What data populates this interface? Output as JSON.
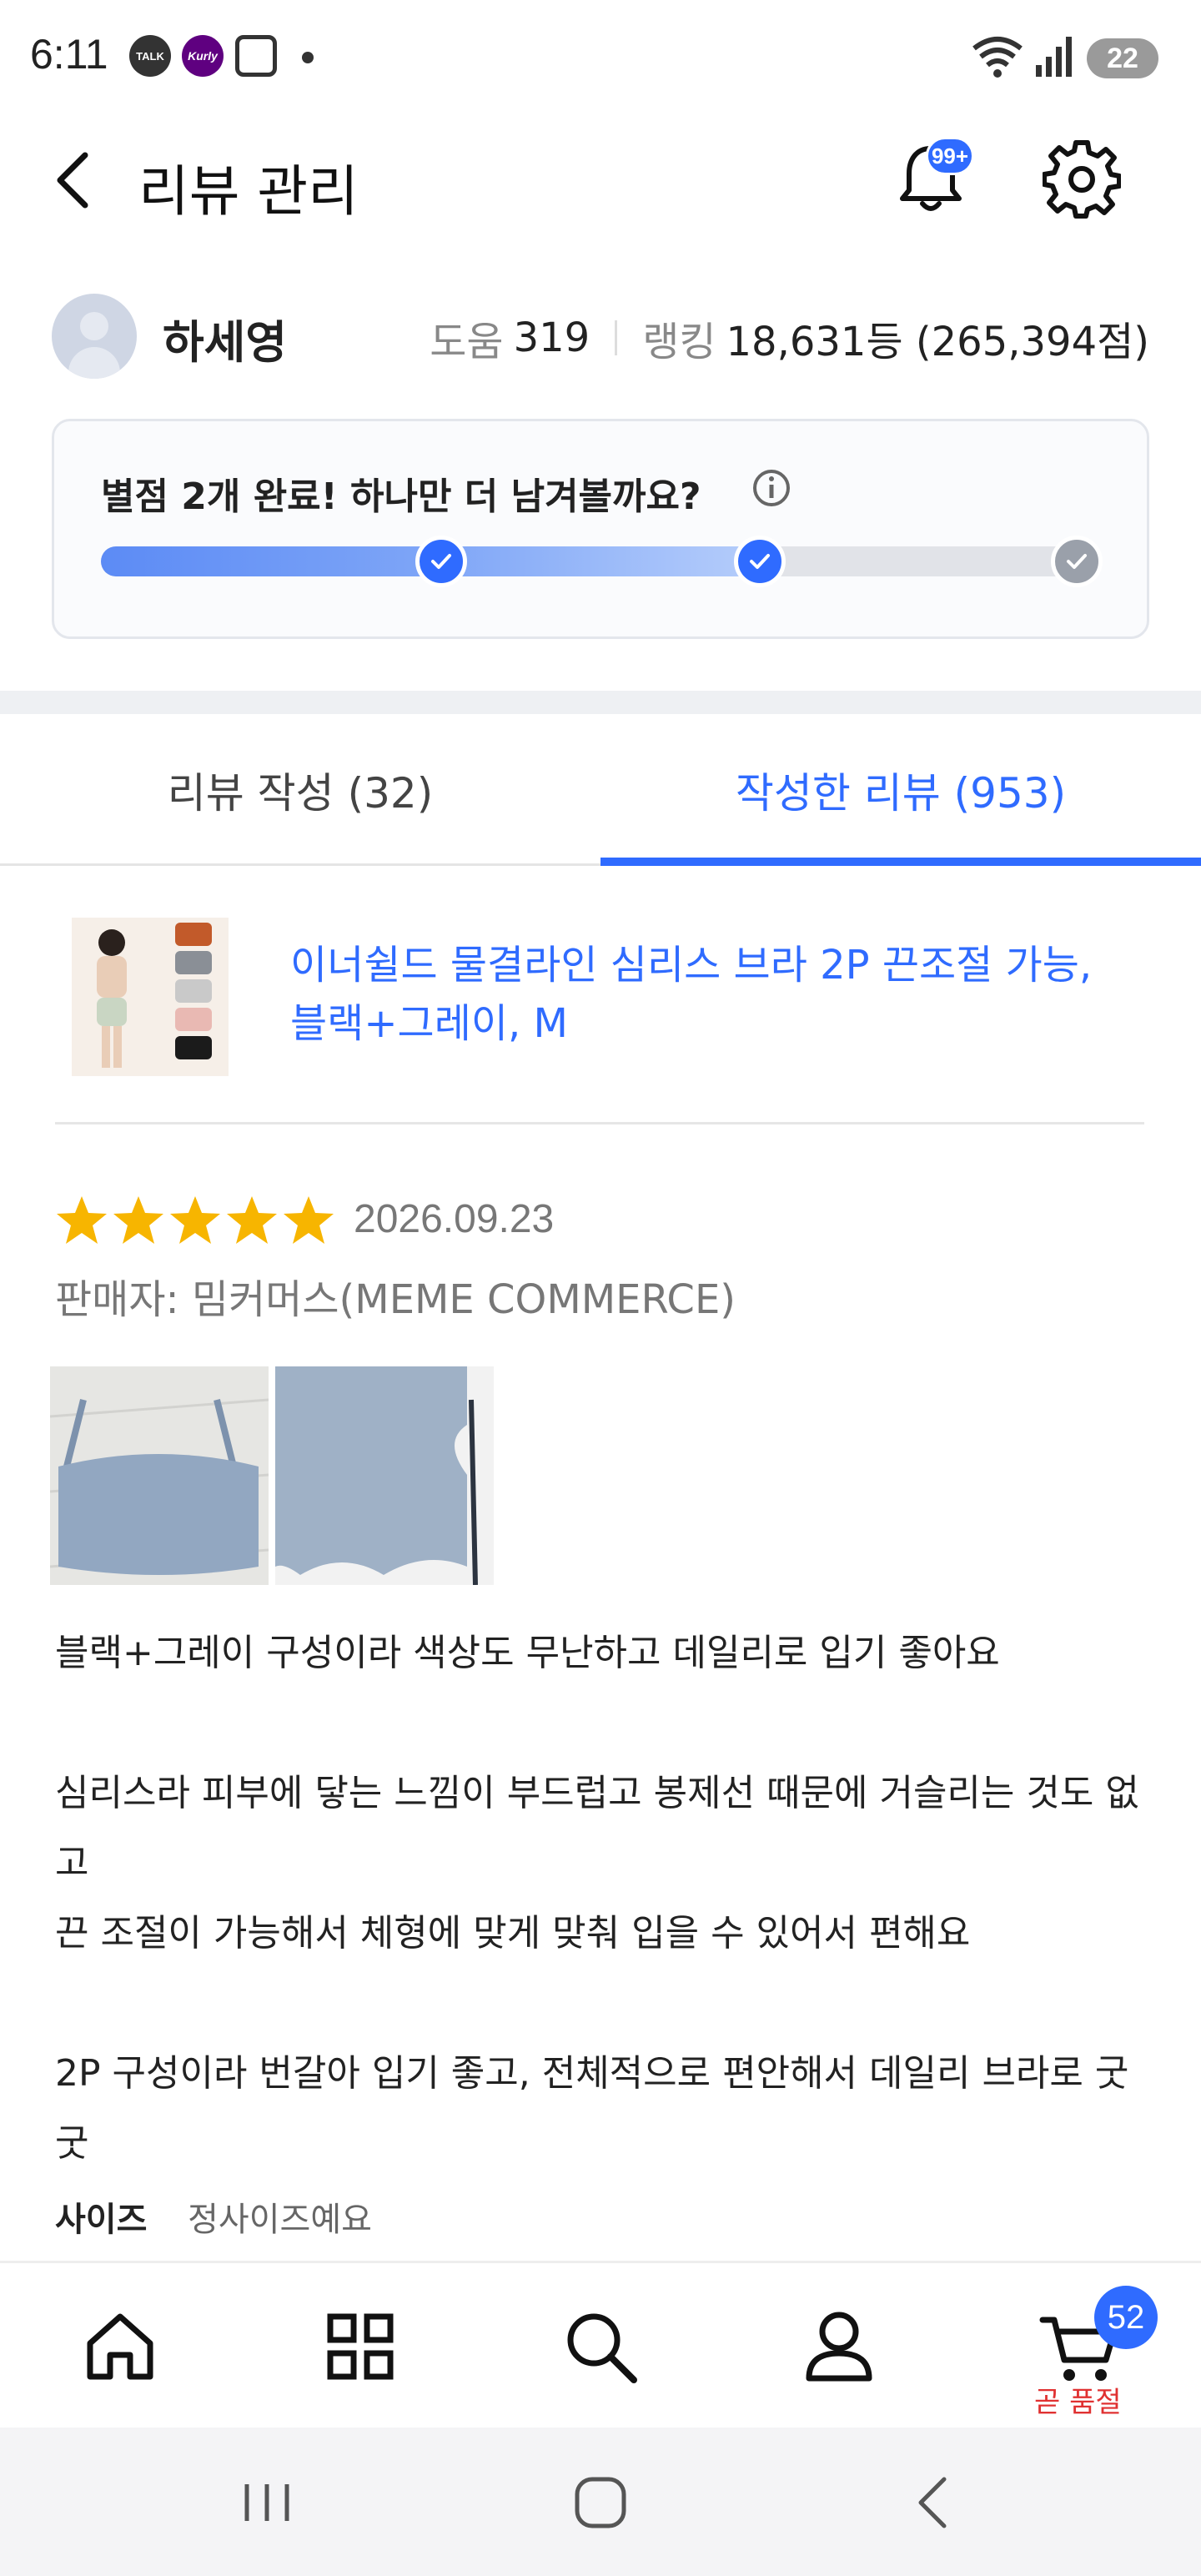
{
  "status_bar": {
    "time": "6:11",
    "talk_icon_label": "TALK",
    "kurly_icon_label": "Kurly",
    "battery": "22"
  },
  "header": {
    "title": "리뷰 관리",
    "notification_badge": "99+"
  },
  "profile": {
    "name": "하세영",
    "help_label": "도움",
    "help_count": "319",
    "ranking_label": "랭킹",
    "ranking_value": "18,631등 (265,394점)"
  },
  "progress": {
    "title": "별점 2개 완료! 하나만 더 남겨볼까요?",
    "completed": 2,
    "total": 3
  },
  "tabs": [
    {
      "label": "리뷰 작성 (32)",
      "active": false
    },
    {
      "label": "작성한 리뷰 (953)",
      "active": true
    }
  ],
  "product": {
    "title": "이너쉴드 물결라인 심리스 브라 2P 끈조절 가능, 블랙+그레이, M"
  },
  "review": {
    "rating": 5,
    "date": "2026.09.23",
    "seller": "판매자: 밈커머스(MEME COMMERCE)",
    "text": "블랙+그레이 구성이라 색상도 무난하고 데일리로 입기 좋아요\n\n심리스라 피부에 닿는 느낌이 부드럽고 봉제선 때문에 거슬리는 것도 없고\n끈 조절이 가능해서 체형에 맞게 맞춰 입을 수 있어서 편해요\n\n2P 구성이라 번갈아 입기 좋고, 전체적으로 편안해서 데일리 브라로 굿굿",
    "size_label": "사이즈",
    "size_value": "정사이즈예요"
  },
  "bottom_nav": {
    "items": [
      "home-icon",
      "category-icon",
      "search-icon",
      "profile-icon",
      "cart-icon"
    ],
    "cart_count": "52",
    "cart_notice": "곧 품절"
  },
  "colors": {
    "accent": "#2f6bff",
    "warning": "#e03131",
    "star": "#f7b500"
  }
}
